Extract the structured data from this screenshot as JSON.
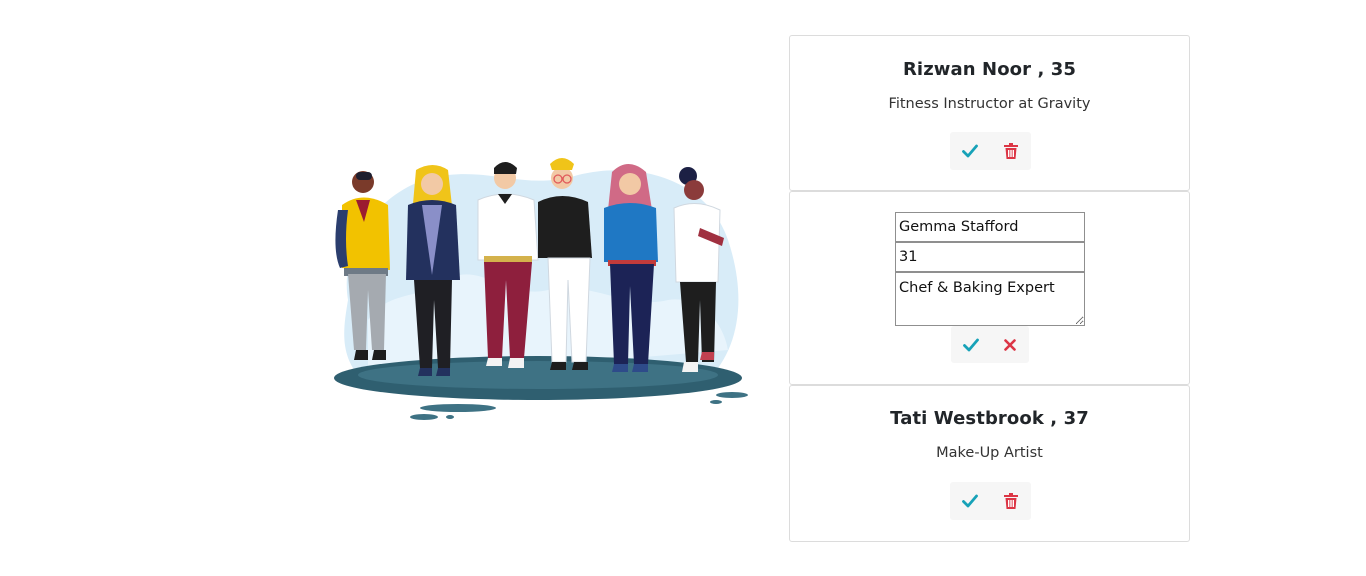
{
  "people": [
    {
      "name": "Rizwan Noor",
      "age": "35",
      "heading": "Rizwan Noor , 35",
      "role": "Fitness Instructor at Gravity",
      "mode": "view"
    },
    {
      "mode": "edit",
      "name_value": "Gemma Stafford",
      "age_value": "31",
      "role_value": "Chef & Baking Expert"
    },
    {
      "name": "Tati Westbrook",
      "age": "37",
      "heading": "Tati Westbrook , 37",
      "role": "Make-Up Artist",
      "mode": "view"
    }
  ],
  "icons": {
    "confirm": "check-icon",
    "delete": "trash-icon",
    "cancel": "close-icon"
  },
  "colors": {
    "confirm": "#17a2b8",
    "danger": "#dc3545"
  }
}
